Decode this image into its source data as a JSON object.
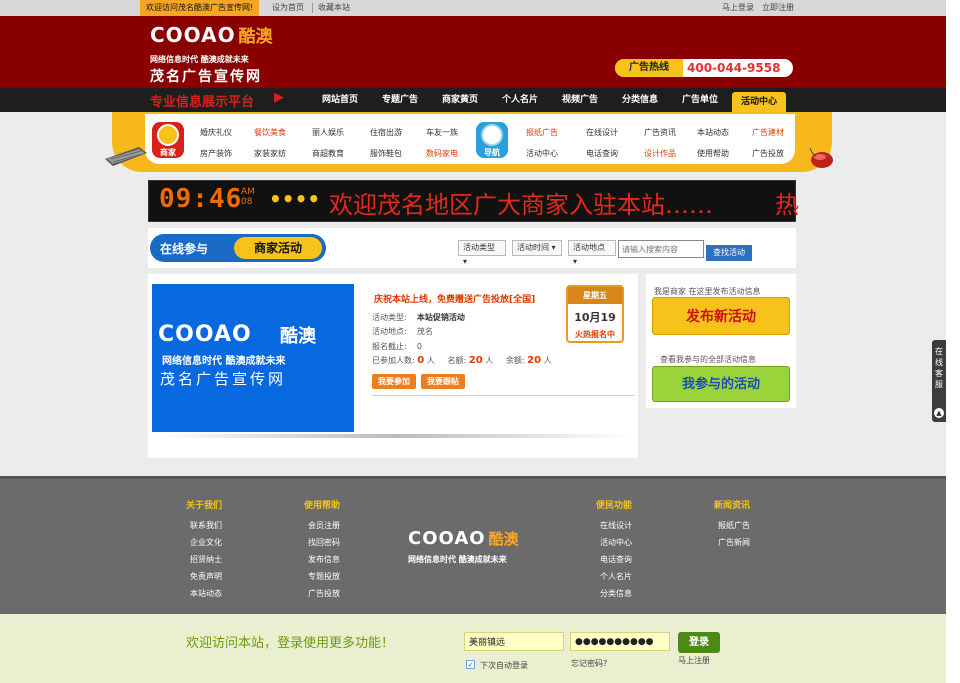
{
  "topbar": {
    "welcome": "欢迎访问茂名酷澳广告宣传网!",
    "set_home": "设为首页",
    "bookmark": "收藏本站",
    "login": "马上登录",
    "register": "立即注册"
  },
  "header": {
    "logo_main": "COOAO",
    "logo_cn": "酷澳",
    "logo_sub": "网络信息时代 酷澳成就未来",
    "logo_big": "茂名广告宣传网",
    "hotline_label": "广告热线",
    "hotline_number": "400-044-9558"
  },
  "nav": {
    "slogan": "专业信息展示平台",
    "items": [
      "网站首页",
      "专题广告",
      "商家黄页",
      "个人名片",
      "视频广告",
      "分类信息",
      "广告单位",
      "活动中心"
    ],
    "active_index": 7
  },
  "categories": {
    "badge_left": "商家",
    "badge_right": "导航",
    "left_row1": [
      "婚庆礼仪",
      "餐饮美食",
      "丽人娱乐",
      "住宿出游",
      "车友一族"
    ],
    "left_row2": [
      "房产装饰",
      "家装家纺",
      "商超教育",
      "服饰鞋包",
      "数码家电"
    ],
    "right_row1": [
      "报纸广告",
      "在线设计",
      "广告资讯",
      "本站动态",
      "广告建材"
    ],
    "right_row2": [
      "活动中心",
      "电话查询",
      "设计作品",
      "使用帮助",
      "广告投放"
    ],
    "hot_left": [
      "餐饮美食",
      "数码家电"
    ],
    "hot_right": [
      "报纸广告",
      "设计作品",
      "广告建材"
    ]
  },
  "led": {
    "clock": "09:46",
    "am": "AM",
    "sec": "08",
    "dots": "••••",
    "scroll_text": "欢迎茂名地区广大商家入驻本站……",
    "tail": "热"
  },
  "search": {
    "title_a": "在线参与",
    "title_b": "商家活动",
    "type": "活动类型",
    "time": "活动时间",
    "place": "活动地点",
    "placeholder": "请输入搜索内容",
    "button": "查找活动"
  },
  "event": {
    "title": "庆祝本站上线，免费赠送广告投放[全国]",
    "type_label": "活动类型:",
    "type_value": "本站促销活动",
    "place_label": "活动地点:",
    "place_value": "茂名",
    "deadline_label": "报名截止:",
    "deadline_value": "0",
    "joined_label": "已参加人数:",
    "joined_value": "0",
    "unit": "人",
    "quota_label": "名额:",
    "quota_value": "20",
    "remain_label": "余额:",
    "remain_value": "20",
    "join_btn": "我要参加",
    "follow_btn": "我要跟帖",
    "weekday": "星期五",
    "date": "10月19",
    "status": "火热报名中"
  },
  "card_logo": {
    "main": "COOAO",
    "cn": "酷澳",
    "sub": "网络信息时代  酷澳成就未来",
    "big": "茂名广告宣传网"
  },
  "right_panel": {
    "merchant_text": "我是商家  在这里发布活动信息",
    "publish_btn": "发布新活动",
    "view_text": "查看我参与的全部活动信息",
    "join_btn": "我参与的活动"
  },
  "side_widget": {
    "text": "在线客服",
    "icon": "up-arrow-icon"
  },
  "footer": {
    "col1": {
      "title": "关于我们",
      "links": [
        "联系我们",
        "企业文化",
        "招贤纳士",
        "免责声明",
        "本站动态"
      ]
    },
    "col2": {
      "title": "使用帮助",
      "links": [
        "会员注册",
        "找回密码",
        "发布信息",
        "专题投放",
        "广告投放"
      ]
    },
    "col3": {
      "title": "便民功能",
      "links": [
        "在线设计",
        "活动中心",
        "电话查询",
        "个人名片",
        "分类信息"
      ]
    },
    "col4": {
      "title": "新闻资讯",
      "links": [
        "报纸广告",
        "广告新闻"
      ]
    },
    "logo_main": "COOAO",
    "logo_cn": "酷澳",
    "logo_sub": "网络信息时代 酷澳成就未来"
  },
  "login": {
    "message": "欢迎访问本站，登录使用更多功能！",
    "username": "美丽镇远",
    "password": "●●●●●●●●●●",
    "button": "登录",
    "remember": "下次自动登录",
    "forgot": "忘记密码?",
    "register": "马上注册"
  },
  "colors": {
    "header_red": "#8a0000",
    "accent_yellow": "#f6c21b",
    "accent_orange": "#f07d1c",
    "blue": "#1a6bc5",
    "footer_gray": "#6b6b6b"
  }
}
